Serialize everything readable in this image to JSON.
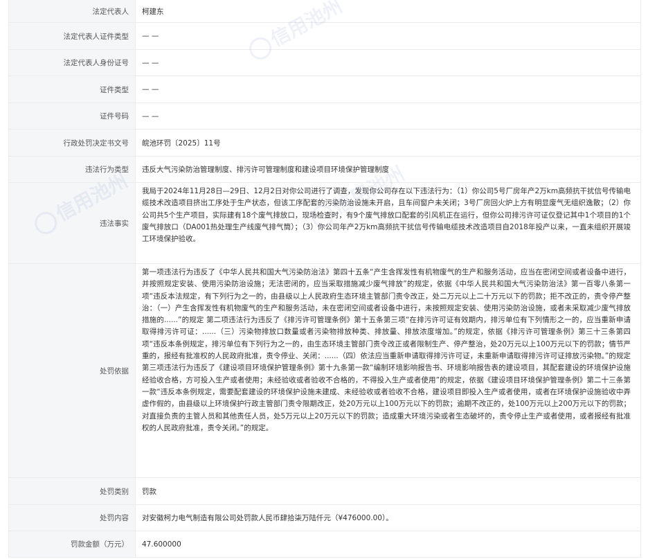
{
  "rows": [
    {
      "label": "法定代表人",
      "value": "柯建东"
    },
    {
      "label": "法定代表人证件类型",
      "value": "— —"
    },
    {
      "label": "法定代表人身份证号",
      "value": "— —"
    },
    {
      "label": "证件类型",
      "value": "— —"
    },
    {
      "label": "证件号码",
      "value": "— —"
    },
    {
      "label": "行政处罚决定书文号",
      "value": "皖池环罚〔2025〕11号"
    },
    {
      "label": "违法行为类型",
      "value": "违反大气污染防治管理制度、排污许可管理制度和建设项目环境保护管理制度"
    },
    {
      "label": "违法事实",
      "value": "我局于2024年11月28日—29日、12月2日对你公司进行了调查，发现你公司存在以下违法行为：（1）你公司5号厂房年产2万km高频抗干扰信号传输电缆技术改造项目挤出工序处于生产状态，但该工序配套的污染防治设施未开启，且车间窗户未关闭；3号厂房回火炉上方有明显废气无组织逸散；（2）你公司共5个生产项目，实际建有18个废气排放口，现场检查时，有9个废气排放口配套的引风机正在运行，但你公司排污许可证仅登记其中1个项目的1个废气排放口（DA001热处理生产线废气排气筒）；（3）你公司年产2万km高频抗干扰信号传输电缆技术改造项目自2018年投产以来，一直未组织开展竣工环境保护验收。"
    },
    {
      "label": "处罚依据",
      "value": "第一项违法行为违反了《中华人民共和国大气污染防治法》第四十五条“产生含挥发性有机物废气的生产和服务活动，应当在密闭空间或者设备中进行，并按照规定安装、使用污染防治设施；无法密闭的，应当采取措施减少废气排放”的规定，依据《中华人民共和国大气污染防治法》第一百零八条第一项“违反本法规定，有下列行为之一的，由县级以上人民政府生态环境主管部门责令改正，处二万元以上二十万元以下的罚款；拒不改正的，责令停产整治：（一）产生含挥发性有机物废气的生产和服务活动，未在密闭空间或者设备中进行，未按照规定安装、使用污染防治设施，或者未采取减少废气排放措施的......”的规定 第二项违法行为违反了《排污许可管理条例》第十五条第三项“在排污许可证有效期内，排污单位有下列情形之一的，应当重新申请取得排污许可证：......（三）污染物排放口数量或者污染物排放种类、排放量、排放浓度增加。”的规定，依据《排污许可管理条例》第三十三条第四项“违反本条例规定，排污单位有下列行为之一的，由生态环境主管部门责令改正或者限制生产、停产整治，处20万元以上100万元以下的罚款；情节严重的，报经有批准权的人民政府批准，责令停业、关闭：......（四）依法应当重新申请取得排污许可证，未重新申请取得排污许可证排放污染物。”的规定 第三项违法行为违反了《建设项目环境保护管理条例》第十九条第一款“编制环境影响报告书、环境影响报告表的建设项目，其配套建设的环境保护设施经验收合格，方可投入生产或者使用；未经验收或者验收不合格的，不得投入生产或者使用”的规定，依据《建设项目环境保护管理条例》第二十三条第一款“违反本条例规定，需要配套建设的环境保护设施未建成、未经验收或者验收不合格，建设项目即投入生产或者使用，或者在环境保护设施验收中弄虚作假的，由县级以上环境保护行政主管部门责令限期改正，处20万元以上100万元以下的罚款；逾期不改正的，处100万元以上200万元以下的罚款；对直接负责的主管人员和其他责任人员，处5万元以上20万元以下的罚款；造成重大环境污染或者生态破坏的，责令停止生产或者使用，或者报经有批准权的人民政府批准，责令关闭。”的规定。"
    },
    {
      "label": "处罚类别",
      "value": "罚款"
    },
    {
      "label": "处罚内容",
      "value": "对安徽柯力电气制造有限公司处罚款人民币肆拾柒万陆仟元（¥476000.00）。"
    },
    {
      "label": "罚款金额（万元）",
      "value": "47.600000"
    }
  ],
  "watermark": {
    "text": "信用池州"
  }
}
